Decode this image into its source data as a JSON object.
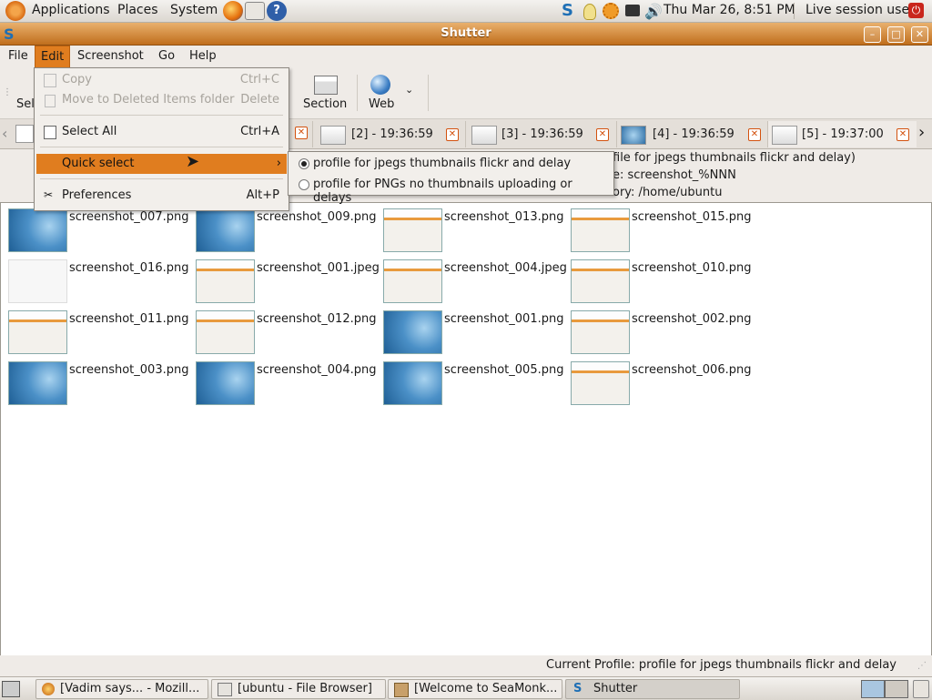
{
  "top_panel": {
    "menus": [
      "Applications",
      "Places",
      "System"
    ],
    "clock": "Thu Mar 26,  8:51 PM",
    "user": "Live session user"
  },
  "window": {
    "title": "Shutter"
  },
  "menubar": [
    "File",
    "Edit",
    "Screenshot",
    "Go",
    "Help"
  ],
  "toolbar": {
    "partial_label": "Sel",
    "section_label": "Section",
    "web_label": "Web"
  },
  "tabs": [
    {
      "label": "[2] - 19:36:59"
    },
    {
      "label": "[3] - 19:36:59"
    },
    {
      "label": "[4] - 19:36:59"
    },
    {
      "label": "[5] - 19:37:00"
    }
  ],
  "info": {
    "line1": "file for jpegs thumbnails flickr and delay)",
    "line2": "e: screenshot_%NNN",
    "line3": "ory: /home/ubuntu"
  },
  "edit_menu": {
    "copy": {
      "label": "Copy",
      "accel": "Ctrl+C"
    },
    "move_deleted": {
      "label": "Move to Deleted Items folder",
      "accel": "Delete"
    },
    "select_all": {
      "label": "Select All",
      "accel": "Ctrl+A"
    },
    "quick_select": {
      "label": "Quick select"
    },
    "preferences": {
      "label": "Preferences",
      "accel": "Alt+P"
    }
  },
  "quick_select_submenu": [
    {
      "label": "profile for jpegs thumbnails flickr and delay",
      "selected": true
    },
    {
      "label": "profile for PNGs no thumbnails uploading or delays",
      "selected": false
    }
  ],
  "files": [
    {
      "name": "screenshot_007.png",
      "style": "blue"
    },
    {
      "name": "screenshot_009.png",
      "style": "blue"
    },
    {
      "name": "screenshot_013.png",
      "style": "ui"
    },
    {
      "name": "screenshot_015.png",
      "style": "ui"
    },
    {
      "name": "screenshot_016.png",
      "style": "white"
    },
    {
      "name": "screenshot_001.jpeg",
      "style": "ui"
    },
    {
      "name": "screenshot_004.jpeg",
      "style": "ui"
    },
    {
      "name": "screenshot_010.png",
      "style": "ui"
    },
    {
      "name": "screenshot_011.png",
      "style": "ui"
    },
    {
      "name": "screenshot_012.png",
      "style": "ui"
    },
    {
      "name": "screenshot_001.png",
      "style": "blue"
    },
    {
      "name": "screenshot_002.png",
      "style": "ui"
    },
    {
      "name": "screenshot_003.png",
      "style": "blue"
    },
    {
      "name": "screenshot_004.png",
      "style": "blue"
    },
    {
      "name": "screenshot_005.png",
      "style": "blue"
    },
    {
      "name": "screenshot_006.png",
      "style": "ui"
    }
  ],
  "statusbar": {
    "text": "Current Profile: profile for jpegs thumbnails flickr and delay"
  },
  "taskbar": [
    {
      "label": "[Vadim says... - Mozill..."
    },
    {
      "label": "[ubuntu - File Browser]"
    },
    {
      "label": "[Welcome to SeaMonk..."
    },
    {
      "label": "Shutter"
    }
  ]
}
